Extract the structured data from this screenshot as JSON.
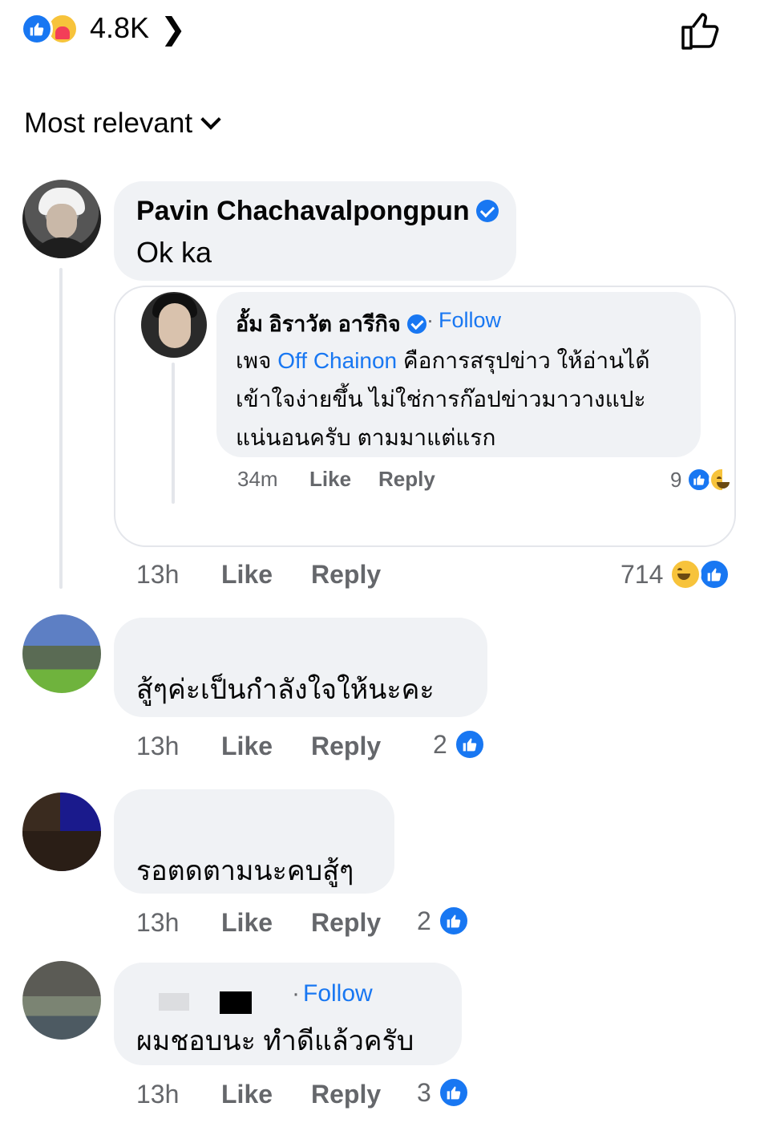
{
  "reactions_bar": {
    "total": "4.8K",
    "icons": [
      "like-reaction-icon",
      "care-reaction-icon"
    ]
  },
  "sort": {
    "label": "Most relevant"
  },
  "comments": [
    {
      "author": "Pavin Chachavalpongpun",
      "verified": true,
      "text": "Ok ka",
      "time": "13h",
      "like_label": "Like",
      "reply_label": "Reply",
      "reaction_count": "714",
      "reactions": [
        "haha",
        "like"
      ],
      "embedded": {
        "author": "อั้ม อิราวัต อารีกิจ",
        "verified": true,
        "follow_label": "Follow",
        "text_before": "เพจ ",
        "mention": "Off Chainon",
        "text_after": " คือการสรุปข่าว ให้อ่านได้เข้าใจง่ายขึ้น ไม่ใช่การก๊อปข่าวมาวางแปะแน่นอนครับ ตามมาแต่แรก",
        "time": "34m",
        "like_label": "Like",
        "reply_label": "Reply",
        "reaction_count": "9",
        "reactions": [
          "like",
          "haha"
        ]
      }
    },
    {
      "text": "สู้ๆค่ะเป็นกำลังใจให้นะคะ",
      "time": "13h",
      "like_label": "Like",
      "reply_label": "Reply",
      "reaction_count": "2",
      "reactions": [
        "like"
      ]
    },
    {
      "text": "รอตดตามนะคบสู้ๆ",
      "time": "13h",
      "like_label": "Like",
      "reply_label": "Reply",
      "reaction_count": "2",
      "reactions": [
        "like"
      ]
    },
    {
      "follow_label": "Follow",
      "text": "ผมชอบนะ ทำดีแล้วครับ",
      "time": "13h",
      "like_label": "Like",
      "reply_label": "Reply",
      "reaction_count": "3",
      "reactions": [
        "like"
      ]
    }
  ],
  "colors": {
    "accent": "#1877f2",
    "bubble": "#f0f2f5",
    "meta_text": "#65676b"
  }
}
